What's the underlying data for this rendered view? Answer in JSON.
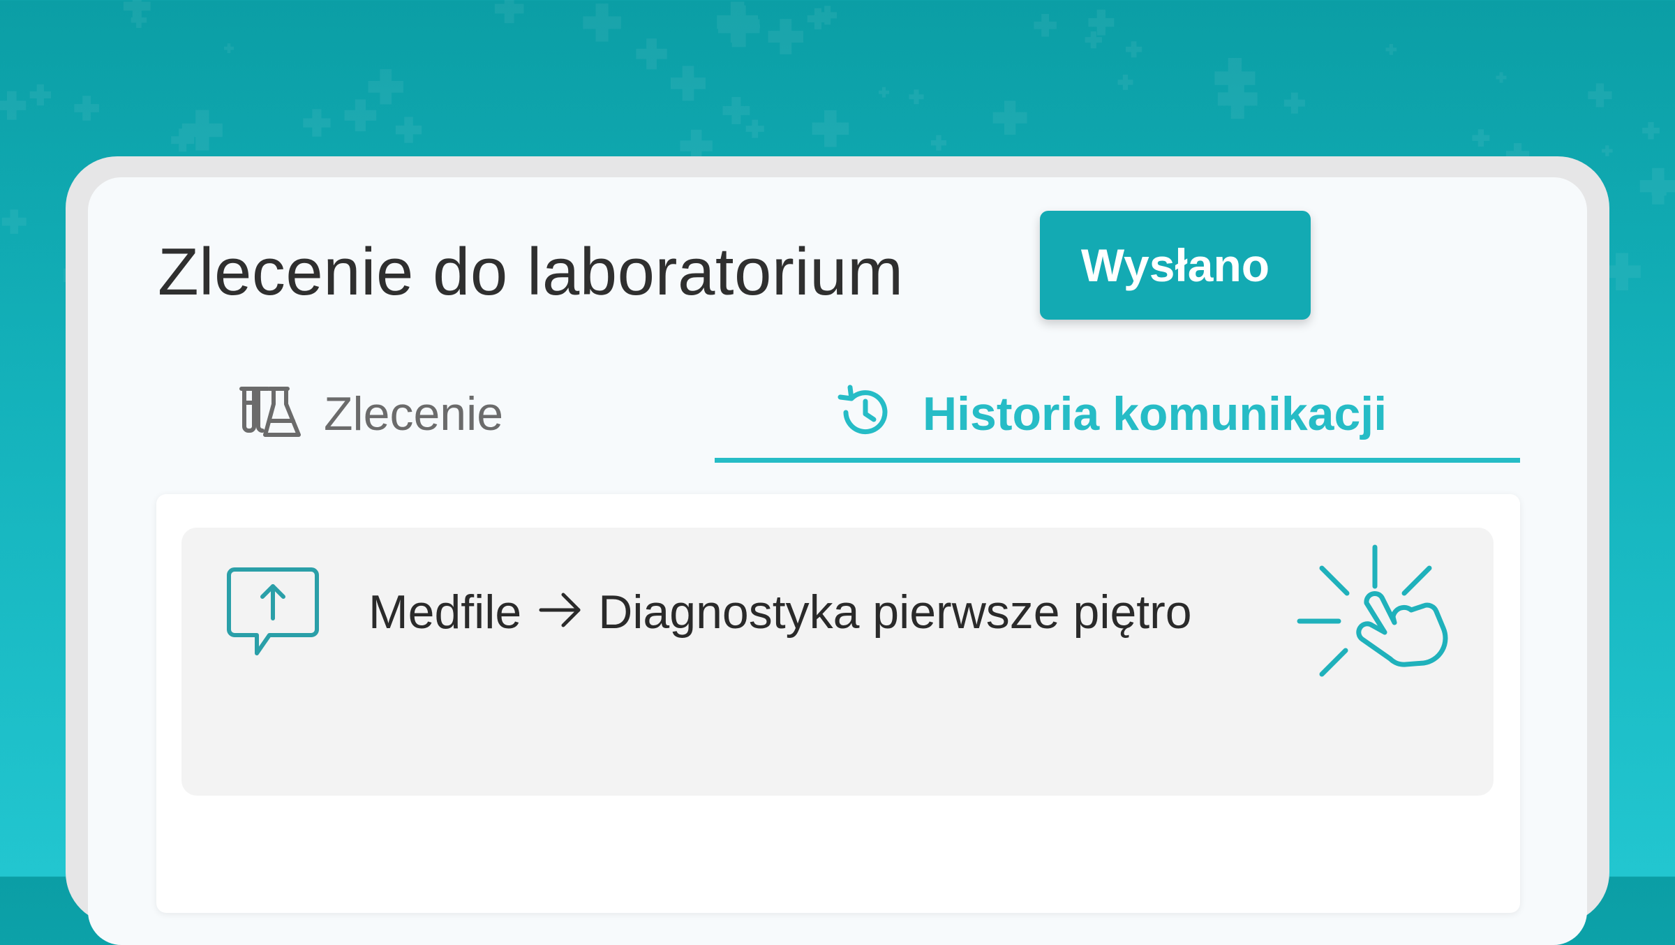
{
  "header": {
    "title": "Zlecenie do laboratorium",
    "status_badge": "Wysłano"
  },
  "tabs": [
    {
      "label": "Zlecenie",
      "icon": "flask-icon",
      "active": false
    },
    {
      "label": "Historia komunikacji",
      "icon": "history-icon",
      "active": true
    }
  ],
  "message": {
    "icon": "message-upload-icon",
    "sender": "Medfile",
    "arrow_icon": "arrow-right-icon",
    "recipient": "Diagnostyka pierwsze piętro",
    "action_icon": "click-hand-icon"
  },
  "colors": {
    "accent": "#13aab3",
    "accent_light": "#26bcc6",
    "background_top": "#0b9ea5",
    "background_bottom": "#22c6d0"
  }
}
